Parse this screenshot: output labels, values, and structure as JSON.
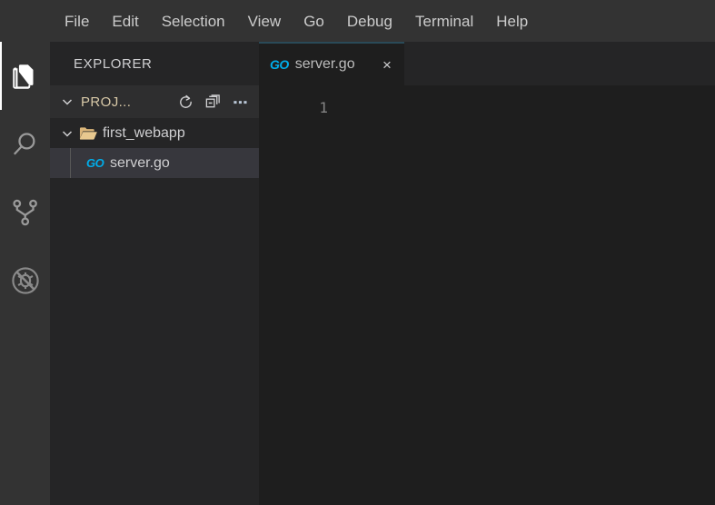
{
  "menubar": {
    "items": [
      {
        "label": "File",
        "name": "menu-file"
      },
      {
        "label": "Edit",
        "name": "menu-edit"
      },
      {
        "label": "Selection",
        "name": "menu-selection"
      },
      {
        "label": "View",
        "name": "menu-view"
      },
      {
        "label": "Go",
        "name": "menu-go"
      },
      {
        "label": "Debug",
        "name": "menu-debug"
      },
      {
        "label": "Terminal",
        "name": "menu-terminal"
      },
      {
        "label": "Help",
        "name": "menu-help"
      }
    ]
  },
  "activitybar": {
    "items": [
      {
        "icon": "files-explorer-icon",
        "active": true
      },
      {
        "icon": "search-icon",
        "active": false
      },
      {
        "icon": "source-control-branch-icon",
        "active": false
      },
      {
        "icon": "run-and-debug-icon",
        "active": false
      }
    ]
  },
  "sidebar": {
    "title": "EXPLORER",
    "section": {
      "label": "PROJ...",
      "actions": [
        {
          "icon": "refresh-icon"
        },
        {
          "icon": "collapse-all-icon"
        },
        {
          "icon": "more-actions-ellipsis-icon"
        }
      ]
    },
    "tree": {
      "folder": {
        "label": "first_webapp",
        "expanded": true
      },
      "files": [
        {
          "label": "server.go",
          "icon": "go-file-icon",
          "selected": true
        }
      ]
    }
  },
  "editor": {
    "tabs": [
      {
        "label": "server.go",
        "icon": "go-file-icon",
        "active": true,
        "close": "×"
      }
    ],
    "line_numbers": [
      "1"
    ],
    "lines": [
      ""
    ]
  },
  "colors": {
    "menubar_bg": "#333333",
    "activitybar_bg": "#333333",
    "sidebar_bg": "#252526",
    "editor_bg": "#1e1e1e",
    "selection_bg": "#37373d",
    "section_header_bg": "#2e2e2f",
    "go_accent": "#00adea",
    "folder_icon": "#dcb67a",
    "tab_top_border": "#2a4a58",
    "text_primary": "#cfcfd1",
    "line_number": "#858585"
  }
}
